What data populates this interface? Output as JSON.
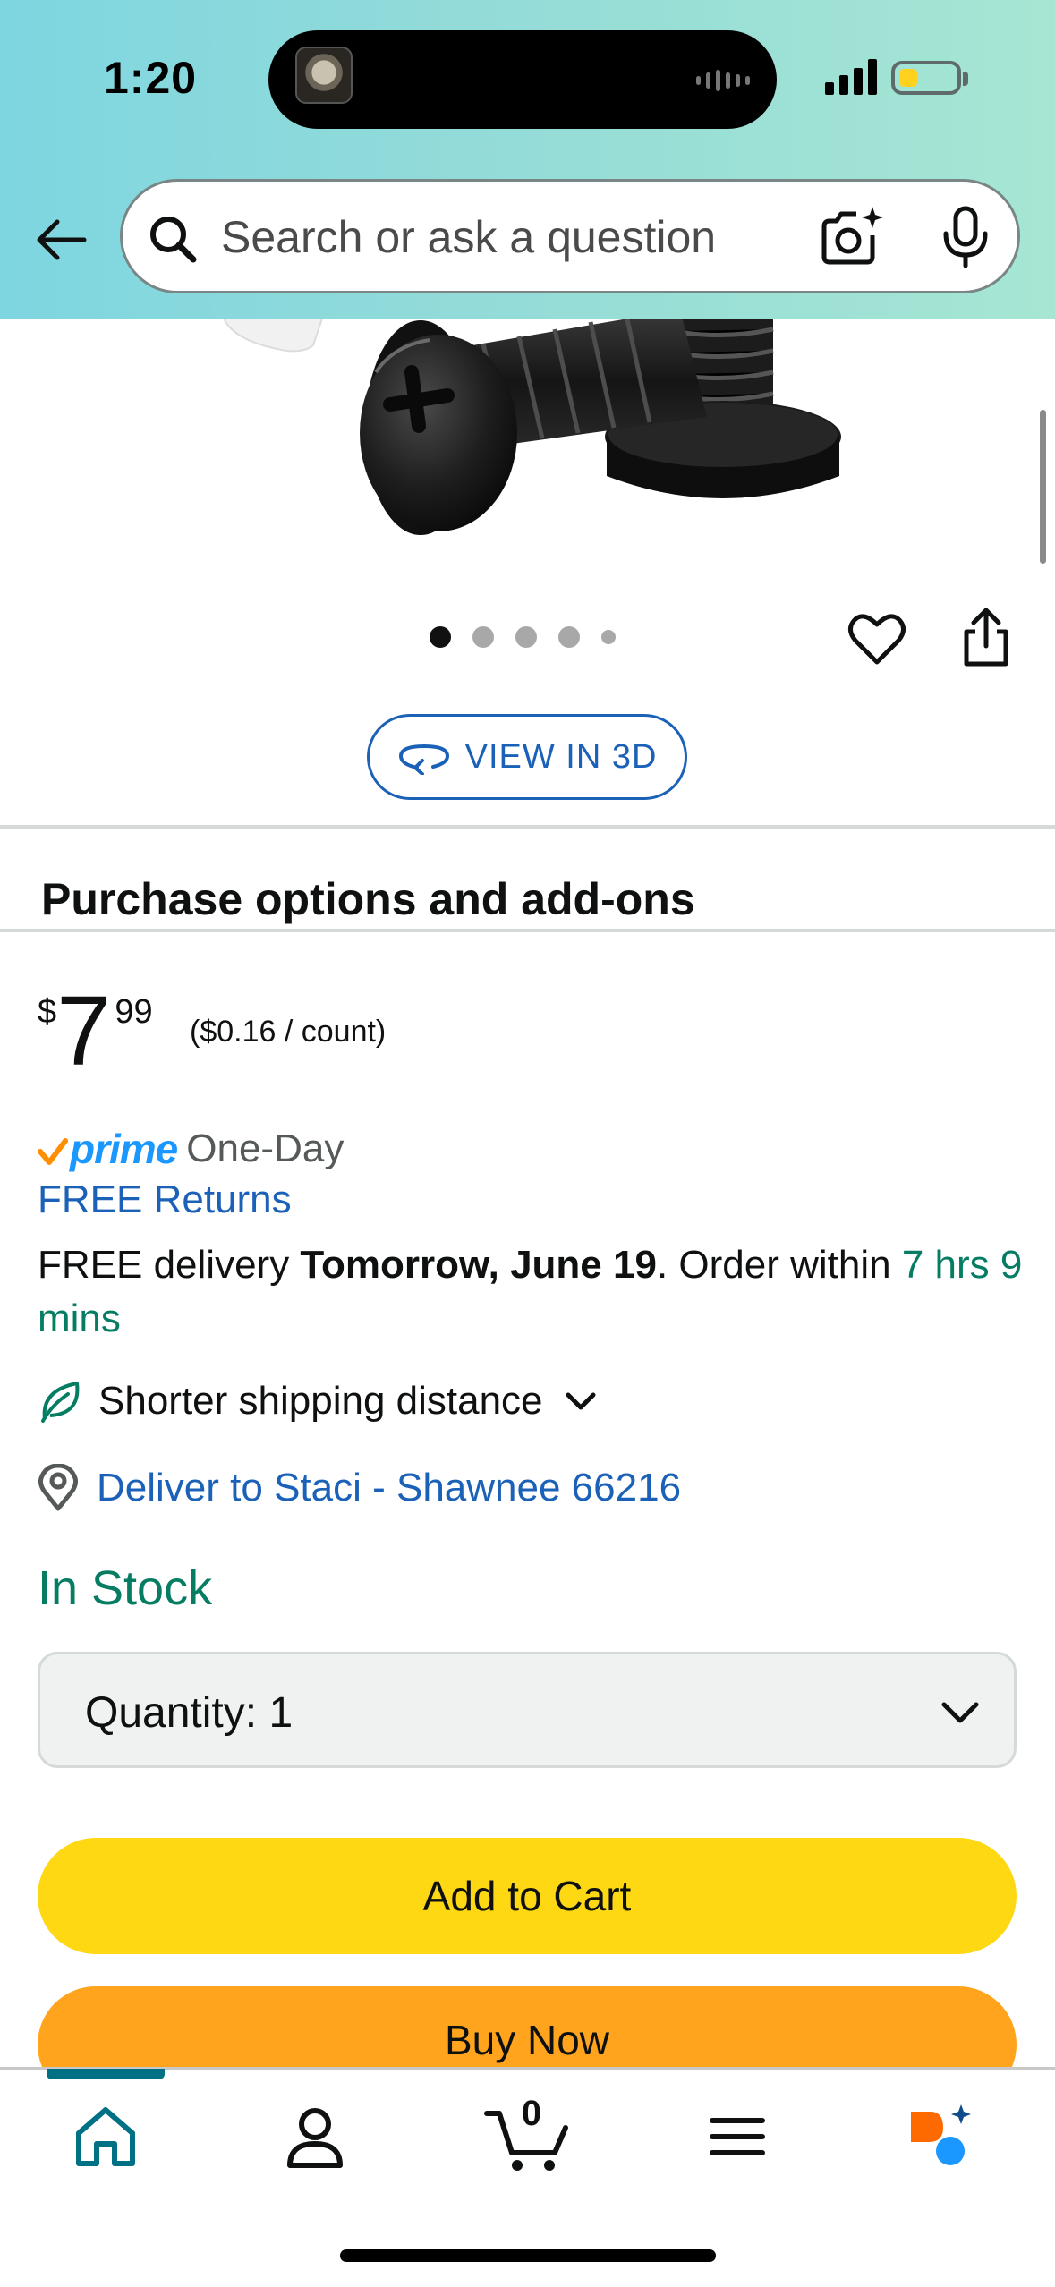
{
  "status_bar": {
    "time": "1:20"
  },
  "search": {
    "placeholder": "Search or ask a question"
  },
  "image_carousel": {
    "image_count": 5,
    "active_index": 0
  },
  "view3d": {
    "label": "VIEW IN 3D"
  },
  "section": {
    "title": "Purchase options and add-ons"
  },
  "price": {
    "currency": "$",
    "whole": "7",
    "fraction": "99",
    "unit_price": "($0.16 / count)"
  },
  "prime": {
    "badge": "prime",
    "speed": "One-Day"
  },
  "returns": {
    "label": "FREE Returns"
  },
  "delivery": {
    "prefix": "FREE delivery ",
    "date": "Tomorrow, June 19",
    "middle": ". Order within ",
    "countdown": "7 hrs 9 mins"
  },
  "shipping": {
    "label": "Shorter shipping distance"
  },
  "deliver_to": {
    "label": "Deliver to Staci - Shawnee 66216"
  },
  "stock": {
    "label": "In Stock"
  },
  "quantity": {
    "label": "Quantity:",
    "value": "1"
  },
  "buttons": {
    "add_to_cart": "Add to Cart",
    "buy_now": "Buy Now"
  },
  "bottom_nav": {
    "cart_count": "0",
    "items": [
      "home",
      "account",
      "cart",
      "menu",
      "rufus"
    ]
  },
  "colors": {
    "link": "#1b61b8",
    "in_stock": "#067d62",
    "add_to_cart": "#ffd814",
    "buy_now": "#ffa41c",
    "prime": "#1a98ff",
    "active_nav": "#007185"
  }
}
